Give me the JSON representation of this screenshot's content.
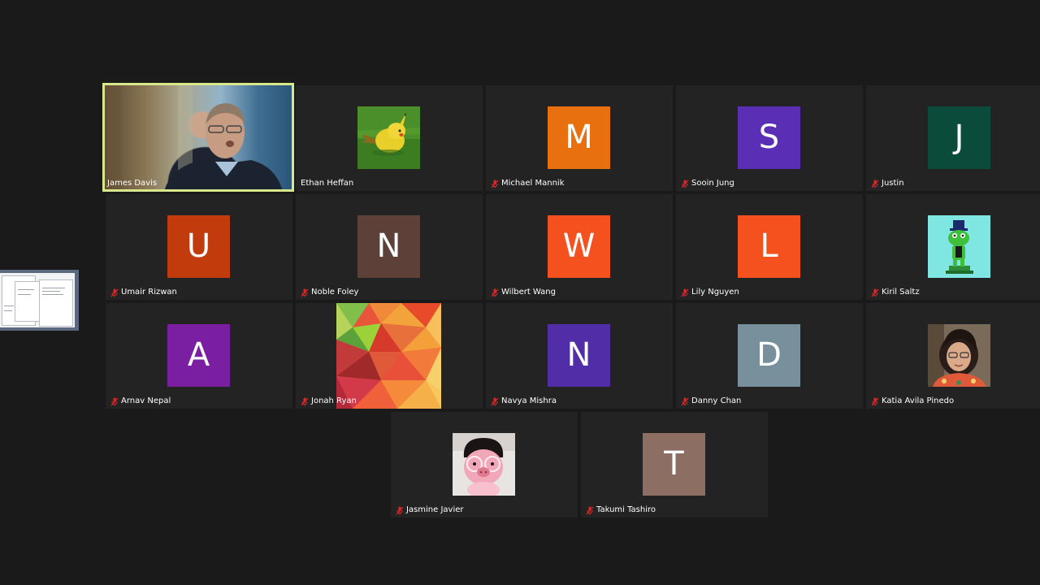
{
  "meeting": {
    "participants": [
      {
        "name": "James Davis",
        "muted": false,
        "media": "video"
      },
      {
        "name": "Ethan Heffan",
        "muted": false,
        "media": "photo-pikachu"
      },
      {
        "name": "Michael Mannik",
        "muted": true,
        "initial": "M",
        "color": "#e8700e"
      },
      {
        "name": "Sooin Jung",
        "muted": true,
        "initial": "S",
        "color": "#5b2fb5"
      },
      {
        "name": "Justin",
        "muted": true,
        "initial": "J",
        "color": "#0a4b3c"
      },
      {
        "name": "Umair Rizwan",
        "muted": true,
        "initial": "U",
        "color": "#c23b0d"
      },
      {
        "name": "Noble Foley",
        "muted": true,
        "initial": "N",
        "color": "#5d4037"
      },
      {
        "name": "Wilbert Wang",
        "muted": true,
        "initial": "W",
        "color": "#f4511e"
      },
      {
        "name": "Lily Nguyen",
        "muted": true,
        "initial": "L",
        "color": "#f4511e"
      },
      {
        "name": "Kiril Saltz",
        "muted": true,
        "media": "photo-frog"
      },
      {
        "name": "Arnav Nepal",
        "muted": true,
        "initial": "A",
        "color": "#7b1fa2"
      },
      {
        "name": "Jonah Ryan",
        "muted": true,
        "media": "photo-polygon"
      },
      {
        "name": "Navya Mishra",
        "muted": true,
        "initial": "N",
        "color": "#512da8"
      },
      {
        "name": "Danny Chan",
        "muted": true,
        "initial": "D",
        "color": "#78909c"
      },
      {
        "name": "Katia Avila Pinedo",
        "muted": true,
        "media": "photo-person"
      },
      {
        "name": "Jasmine Javier",
        "muted": true,
        "media": "photo-plush"
      },
      {
        "name": "Takumi Tashiro",
        "muted": true,
        "initial": "T",
        "color": "#8d6e63"
      }
    ],
    "colors": {
      "background": "#1a1a1a",
      "tile": "#232323",
      "active_speaker_border": "#d8e78a",
      "muted_icon": "#e02828"
    },
    "icons": {
      "muted": "microphone-muted-icon"
    }
  }
}
